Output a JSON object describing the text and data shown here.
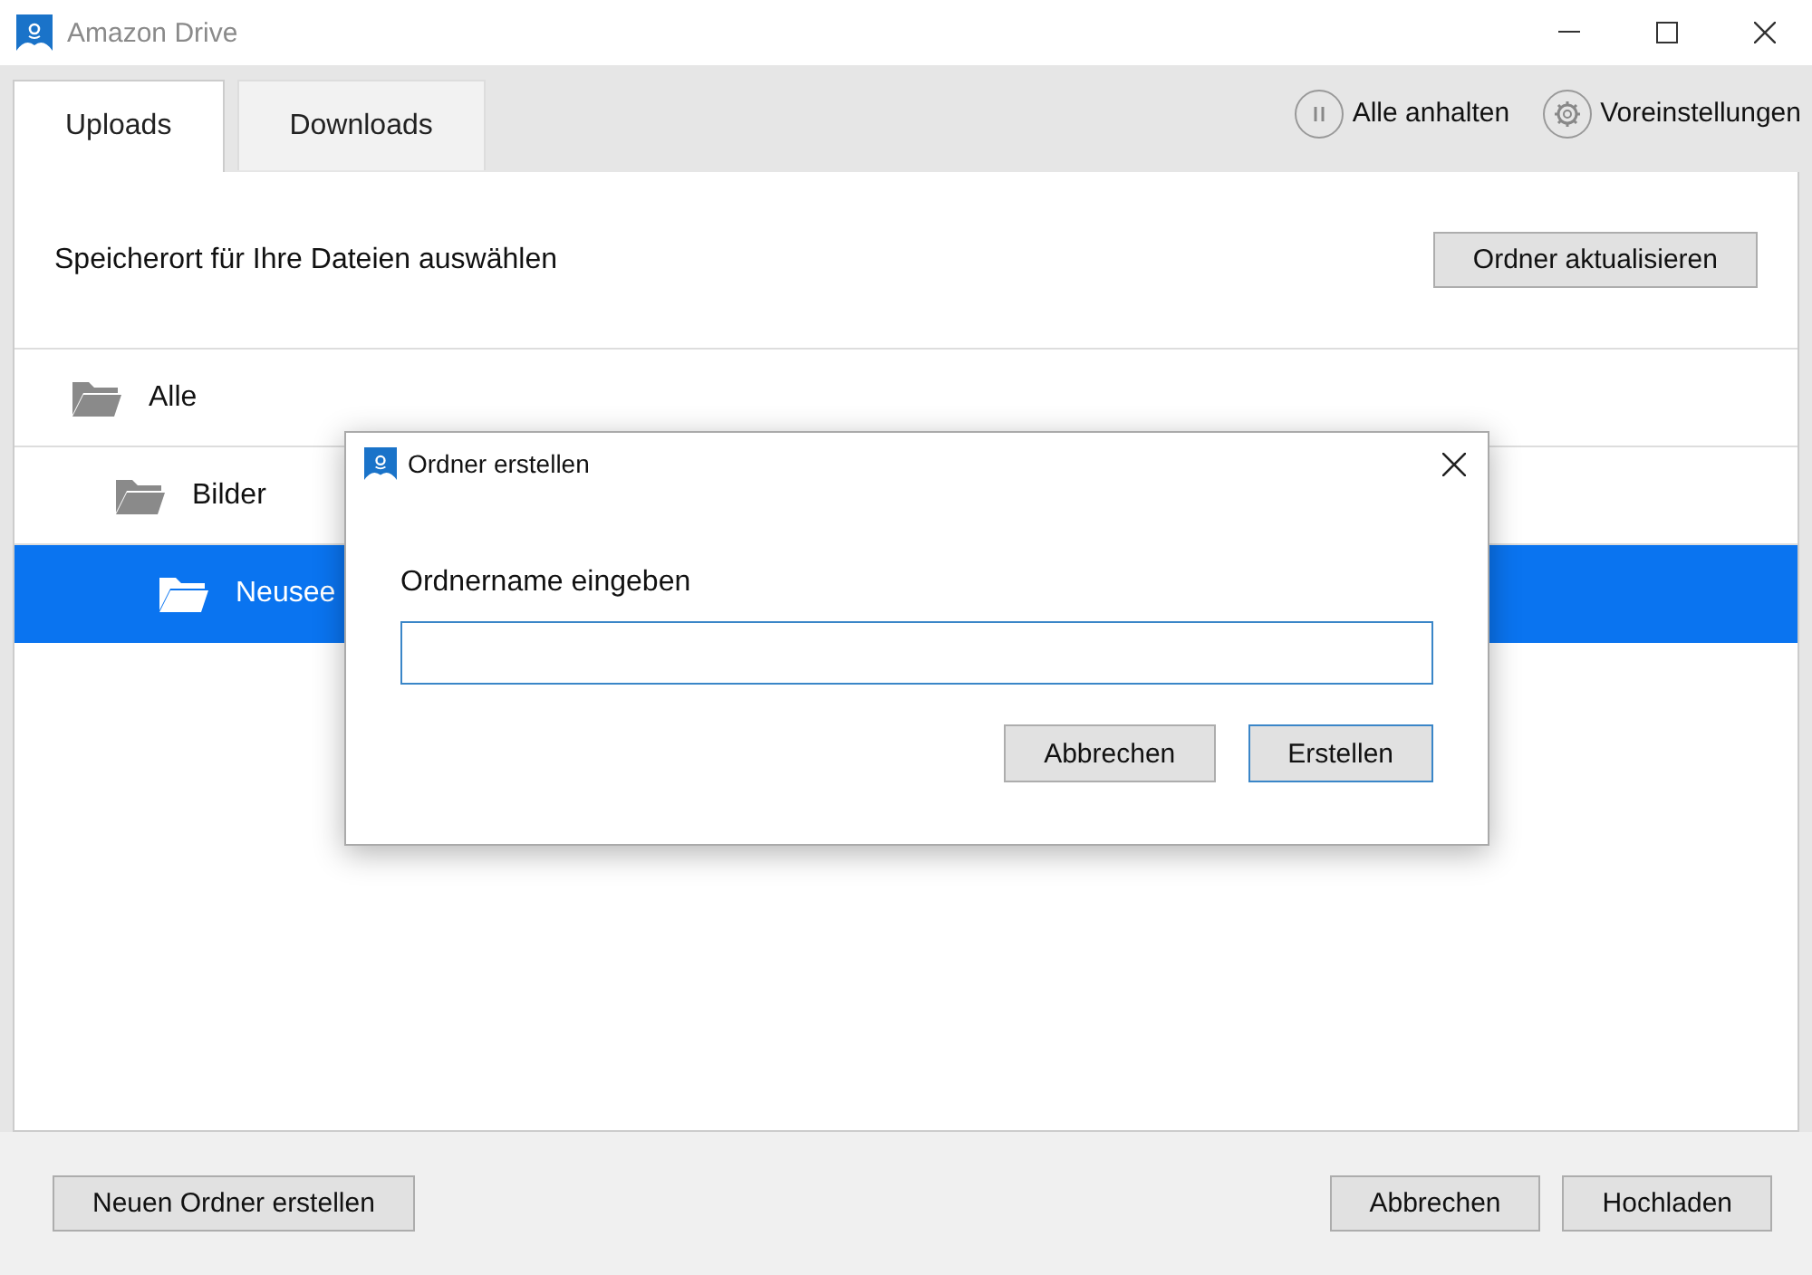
{
  "window": {
    "title": "Amazon Drive"
  },
  "tabs": [
    {
      "label": "Uploads",
      "selected": true
    },
    {
      "label": "Downloads",
      "selected": false
    }
  ],
  "toolbar": [
    {
      "kind": "pause",
      "label": "Alle anhalten"
    },
    {
      "kind": "settings",
      "label": "Voreinstellungen"
    }
  ],
  "header": {
    "text": "Speicherort für Ihre Dateien auswählen",
    "button": "Ordner aktualisieren"
  },
  "tree": [
    {
      "label": "Alle",
      "selected": false,
      "children": [
        {
          "label": "Bilder",
          "selected": false,
          "children": [
            {
              "label": "Neusee",
              "selected": true
            }
          ]
        }
      ]
    }
  ],
  "footer": {
    "left_button": "Neuen Ordner erstellen",
    "right_buttons": [
      {
        "label": "Abbrechen",
        "default": false
      },
      {
        "label": "Hochladen",
        "default": false
      }
    ]
  },
  "dialog": {
    "title": "Ordner erstellen",
    "label": "Ordnername eingeben",
    "buttons": [
      {
        "label": "Abbrechen",
        "default": false
      },
      {
        "label": "Erstellen",
        "default": true
      }
    ]
  }
}
